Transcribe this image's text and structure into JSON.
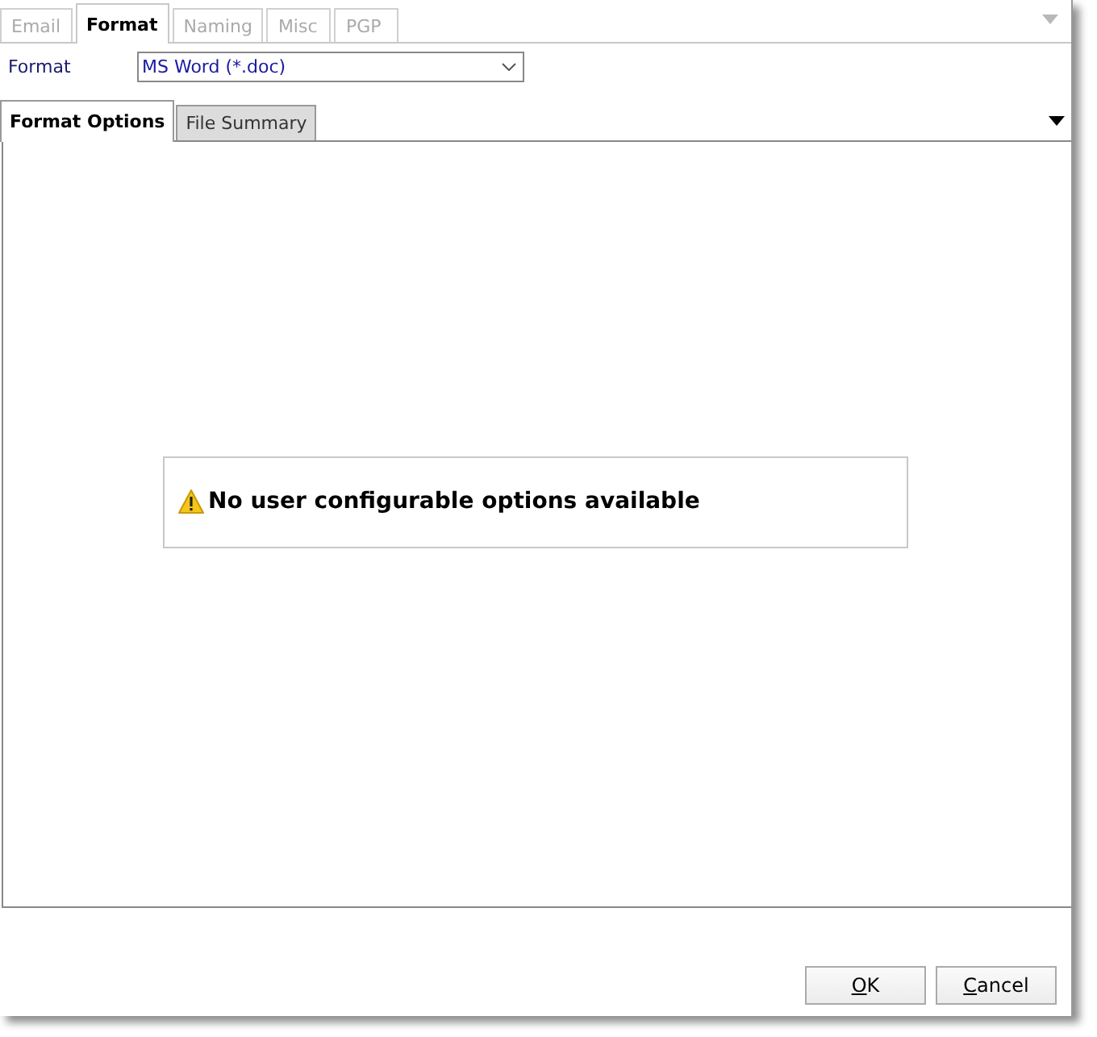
{
  "tabs": [
    {
      "label": "Email",
      "selected": false
    },
    {
      "label": "Format",
      "selected": true
    },
    {
      "label": "Naming",
      "selected": false
    },
    {
      "label": "Misc",
      "selected": false
    },
    {
      "label": "PGP",
      "selected": false
    }
  ],
  "format": {
    "label": "Format",
    "value": "MS Word (*.doc)"
  },
  "sub_tabs": [
    {
      "label": "Format Options",
      "selected": true
    },
    {
      "label": "File Summary",
      "selected": false
    }
  ],
  "message": "No user configurable options available",
  "buttons": [
    {
      "label": "OK"
    },
    {
      "label": "Cancel"
    }
  ]
}
